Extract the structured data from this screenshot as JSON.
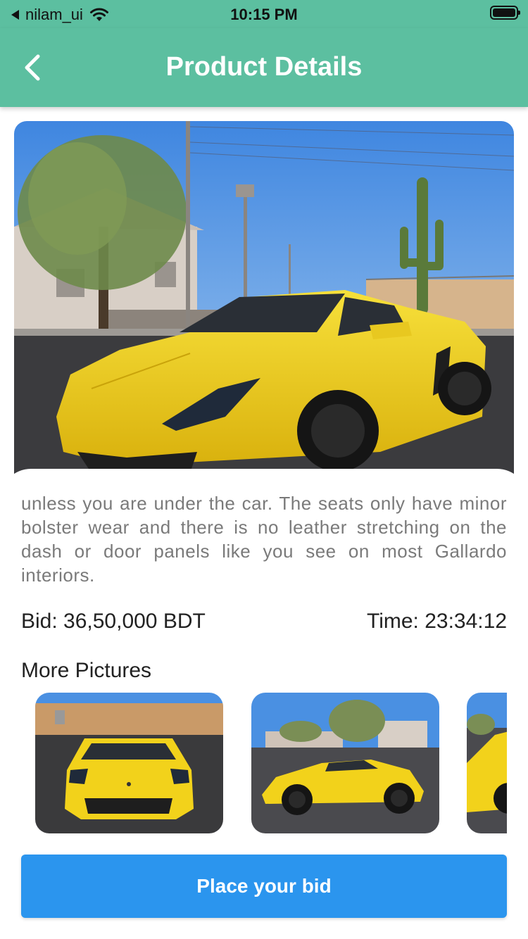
{
  "status_bar": {
    "carrier": "nilam_ui",
    "time": "10:15 PM"
  },
  "app_bar": {
    "title": "Product Details"
  },
  "product": {
    "description": "unless you are under the car. The seats only have minor bolster wear and there is no leather stretching on the dash or door panels like you see on most Gallardo interiors.",
    "bid": "Bid: 36,50,000 BDT",
    "time": "Time: 23:34:12"
  },
  "more_pictures": {
    "title": "More Pictures"
  },
  "actions": {
    "bid_button": "Place your bid"
  },
  "colors": {
    "app_bar": "#5cbfa0",
    "button": "#2b95ee",
    "car": "#f2d21b"
  },
  "icons": [
    "back-arrow-icon",
    "wifi-icon",
    "battery-icon",
    "signal-arrow-icon"
  ]
}
